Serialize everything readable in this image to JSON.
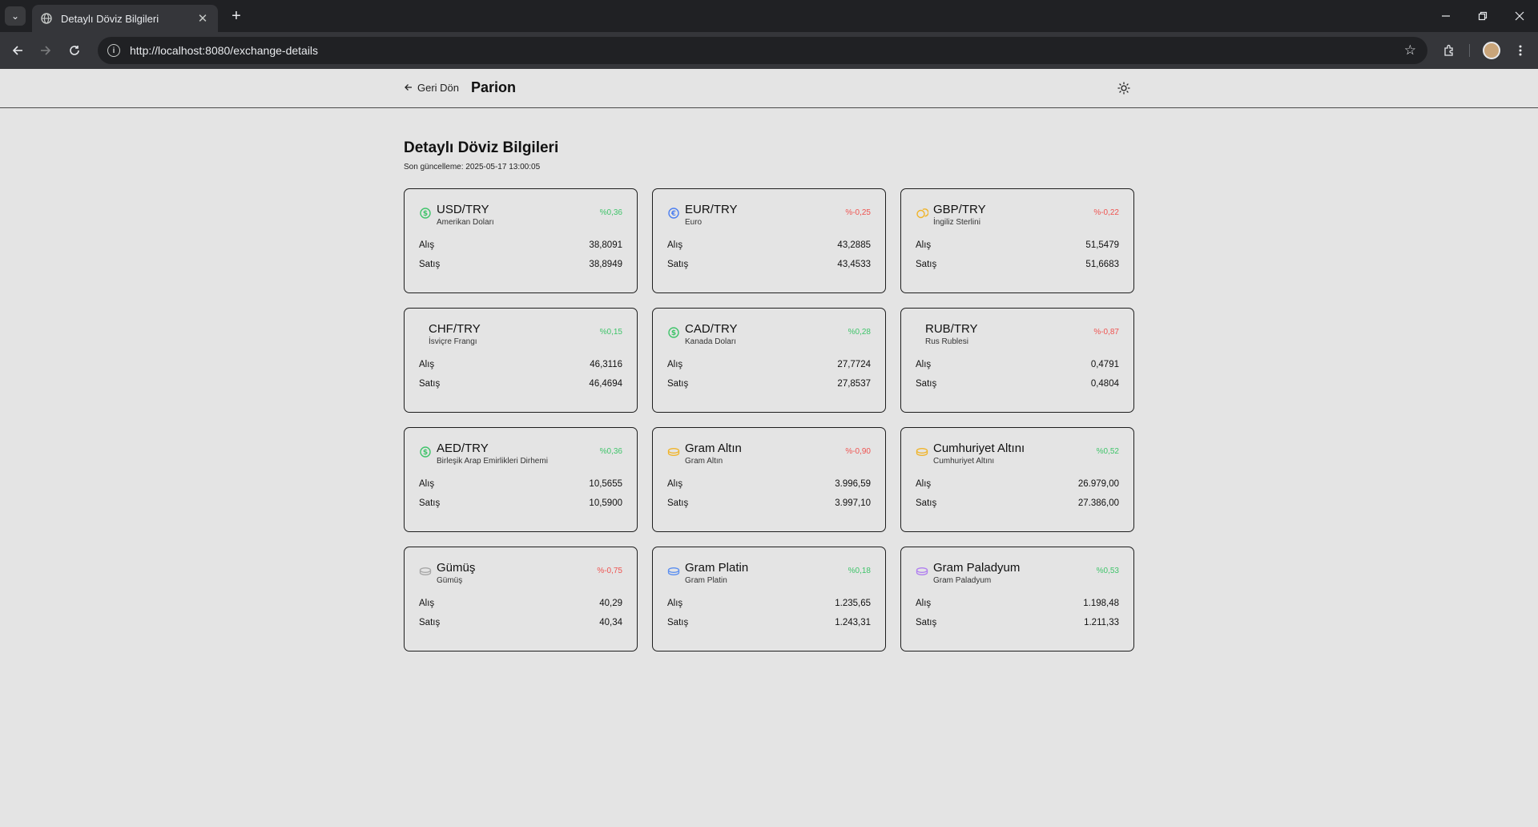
{
  "browser": {
    "tab_title": "Detaylı Döviz Bilgileri",
    "url": "http://localhost:8080/exchange-details"
  },
  "header": {
    "back_label": "Geri Dön",
    "brand": "Parion"
  },
  "main": {
    "title": "Detaylı Döviz Bilgileri",
    "updated": "Son güncelleme: 2025-05-17 13:00:05",
    "buy_label": "Alış",
    "sell_label": "Satış",
    "cards": [
      {
        "code": "USD/TRY",
        "name": "Amerikan Doları",
        "change": "%0,36",
        "trend": "pos",
        "buy": "38,8091",
        "sell": "38,8949",
        "icon": "dollar-icon",
        "icon_color": "#3fc46a"
      },
      {
        "code": "EUR/TRY",
        "name": "Euro",
        "change": "%-0,25",
        "trend": "neg",
        "buy": "43,2885",
        "sell": "43,4533",
        "icon": "euro-icon",
        "icon_color": "#4c7ff0"
      },
      {
        "code": "GBP/TRY",
        "name": "İngiliz Sterlini",
        "change": "%-0,22",
        "trend": "neg",
        "buy": "51,5479",
        "sell": "51,6683",
        "icon": "coins-icon",
        "icon_color": "#f0b429"
      },
      {
        "code": "CHF/TRY",
        "name": "İsviçre Frangı",
        "change": "%0,15",
        "trend": "pos",
        "buy": "46,3116",
        "sell": "46,4694",
        "icon": "",
        "icon_color": ""
      },
      {
        "code": "CAD/TRY",
        "name": "Kanada Doları",
        "change": "%0,28",
        "trend": "pos",
        "buy": "27,7724",
        "sell": "27,8537",
        "icon": "dollar-icon",
        "icon_color": "#3fc46a"
      },
      {
        "code": "RUB/TRY",
        "name": "Rus Rublesi",
        "change": "%-0,87",
        "trend": "neg",
        "buy": "0,4791",
        "sell": "0,4804",
        "icon": "",
        "icon_color": ""
      },
      {
        "code": "AED/TRY",
        "name": "Birleşik Arap Emirlikleri Dirhemi",
        "change": "%0,36",
        "trend": "pos",
        "buy": "10,5655",
        "sell": "10,5900",
        "icon": "dollar-icon",
        "icon_color": "#3fc46a"
      },
      {
        "code": "Gram Altın",
        "name": "Gram Altın",
        "change": "%-0,90",
        "trend": "neg",
        "buy": "3.996,59",
        "sell": "3.997,10",
        "icon": "bar-icon",
        "icon_color": "#f0b429"
      },
      {
        "code": "Cumhuriyet Altını",
        "name": "Cumhuriyet Altını",
        "change": "%0,52",
        "trend": "pos",
        "buy": "26.979,00",
        "sell": "27.386,00",
        "icon": "bar-icon",
        "icon_color": "#f0b429"
      },
      {
        "code": "Gümüş",
        "name": "Gümüş",
        "change": "%-0,75",
        "trend": "neg",
        "buy": "40,29",
        "sell": "40,34",
        "icon": "bar-icon",
        "icon_color": "#a7a7a7"
      },
      {
        "code": "Gram Platin",
        "name": "Gram Platin",
        "change": "%0,18",
        "trend": "pos",
        "buy": "1.235,65",
        "sell": "1.243,31",
        "icon": "bar-icon",
        "icon_color": "#5a8ef0"
      },
      {
        "code": "Gram Paladyum",
        "name": "Gram Paladyum",
        "change": "%0,53",
        "trend": "pos",
        "buy": "1.198,48",
        "sell": "1.211,33",
        "icon": "bar-icon",
        "icon_color": "#b07ef0"
      }
    ]
  },
  "colors": {
    "positive": "#3fc46a",
    "negative": "#ef5350"
  }
}
